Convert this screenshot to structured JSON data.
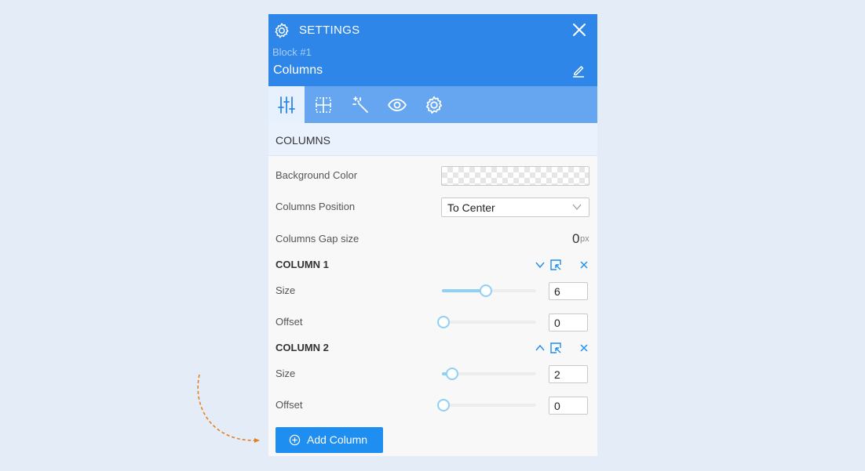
{
  "header": {
    "title": "SETTINGS",
    "block_label": "Block #1",
    "element_name": "Columns"
  },
  "toolbar": {
    "tabs": [
      {
        "icon": "sliders-icon",
        "active": true
      },
      {
        "icon": "grid-icon",
        "active": false
      },
      {
        "icon": "magic-wand-icon",
        "active": false
      },
      {
        "icon": "eye-icon",
        "active": false
      },
      {
        "icon": "gear-icon",
        "active": false
      }
    ]
  },
  "section": {
    "title": "COLUMNS"
  },
  "fields": {
    "background_color_label": "Background Color",
    "columns_position_label": "Columns Position",
    "columns_position_value": "To Center",
    "columns_gap_label": "Columns Gap size",
    "columns_gap_value": "0",
    "columns_gap_unit": "px"
  },
  "columns": [
    {
      "title": "COLUMN 1",
      "size_label": "Size",
      "size_value": "6",
      "size_fraction": 0.45,
      "offset_label": "Offset",
      "offset_value": "0",
      "offset_fraction": 0.0,
      "expanded": true
    },
    {
      "title": "COLUMN 2",
      "size_label": "Size",
      "size_value": "2",
      "size_fraction": 0.09,
      "offset_label": "Offset",
      "offset_value": "0",
      "offset_fraction": 0.0,
      "expanded": false
    }
  ],
  "add_button": {
    "label": "Add Column"
  },
  "colors": {
    "header_bg": "#2f86e9",
    "toolbar_bg": "#66a6f0",
    "accent": "#1e8ef0",
    "slider": "#8fd0f5",
    "arrow": "#e67e22"
  }
}
